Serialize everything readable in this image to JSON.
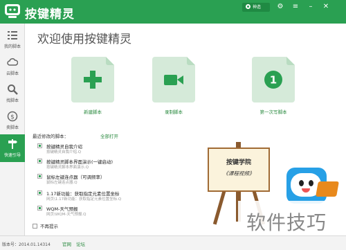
{
  "app": {
    "title": "按键精灵",
    "user": "神造"
  },
  "sidebar": {
    "items": [
      {
        "label": "我的脚本",
        "icon": "list-icon"
      },
      {
        "label": "云脚本",
        "icon": "cloud-icon"
      },
      {
        "label": "找脚本",
        "icon": "search-icon"
      },
      {
        "label": "卖脚本",
        "icon": "dollar-icon"
      },
      {
        "label": "快速引导",
        "icon": "signpost-icon"
      }
    ]
  },
  "main": {
    "welcome": "欢迎使用按键精灵",
    "actions": [
      {
        "label": "新建脚本",
        "icon": "plus-icon"
      },
      {
        "label": "录制脚本",
        "icon": "video-camera-icon"
      },
      {
        "label": "第一次写脚本",
        "icon": "number-one-icon",
        "number": "1"
      }
    ],
    "recent_title": "最近修改的脚本：",
    "open_all": "全部打开",
    "scripts": [
      {
        "name": "按键精灵自我介绍",
        "desc": "按键精灵自我介绍.Q"
      },
      {
        "name": "按键精灵脚本界面演示(一键启动)",
        "desc": "按键精灵脚本界面演示.Q"
      },
      {
        "name": "鼠标左键连点器（可调频率）",
        "desc": "鼠标左键连点器.Q"
      },
      {
        "name": "1.17新功能：获取指定元素位置坐标",
        "desc": "网页\\1.17新功能：获取指定元素位置坐标.Q"
      },
      {
        "name": "WQM-天气预报",
        "desc": "网页\\WQM-天气预报.Q"
      }
    ],
    "no_show": "不再提示"
  },
  "promo": {
    "line1": "按键学院",
    "line2": "《课程视频》"
  },
  "watermark": "软件技巧",
  "status": {
    "version": "版本号：2014.01.14314",
    "link1": "官网",
    "link2": "论坛"
  },
  "colors": {
    "brand_green": "#2aa052",
    "link_green": "#2a8a3f",
    "mascot_blue": "#27a0e6"
  }
}
